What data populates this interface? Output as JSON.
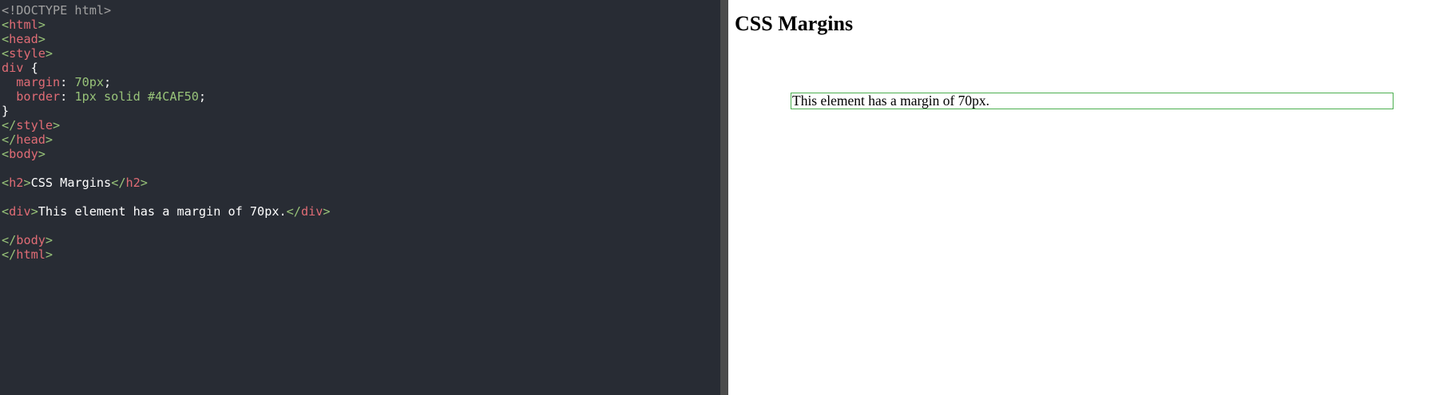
{
  "editor": {
    "lines": [
      [
        {
          "t": "<!DOCTYPE html>",
          "c": "doctype"
        }
      ],
      [
        {
          "t": "<",
          "c": "punct"
        },
        {
          "t": "html",
          "c": "tag"
        },
        {
          "t": ">",
          "c": "punct"
        }
      ],
      [
        {
          "t": "<",
          "c": "punct"
        },
        {
          "t": "head",
          "c": "tag"
        },
        {
          "t": ">",
          "c": "punct"
        }
      ],
      [
        {
          "t": "<",
          "c": "punct"
        },
        {
          "t": "style",
          "c": "tag"
        },
        {
          "t": ">",
          "c": "punct"
        }
      ],
      [
        {
          "t": "div",
          "c": "tag"
        },
        {
          "t": " {",
          "c": "text"
        }
      ],
      [
        {
          "t": "  margin",
          "c": "prop"
        },
        {
          "t": ": ",
          "c": "text"
        },
        {
          "t": "70px",
          "c": "val"
        },
        {
          "t": ";",
          "c": "text"
        }
      ],
      [
        {
          "t": "  border",
          "c": "prop"
        },
        {
          "t": ": ",
          "c": "text"
        },
        {
          "t": "1px solid #4CAF50",
          "c": "val"
        },
        {
          "t": ";",
          "c": "text"
        }
      ],
      [
        {
          "t": "}",
          "c": "text"
        }
      ],
      [
        {
          "t": "</",
          "c": "punct"
        },
        {
          "t": "style",
          "c": "tag"
        },
        {
          "t": ">",
          "c": "punct"
        }
      ],
      [
        {
          "t": "</",
          "c": "punct"
        },
        {
          "t": "head",
          "c": "tag"
        },
        {
          "t": ">",
          "c": "punct"
        }
      ],
      [
        {
          "t": "<",
          "c": "punct"
        },
        {
          "t": "body",
          "c": "tag"
        },
        {
          "t": ">",
          "c": "punct"
        }
      ],
      [],
      [
        {
          "t": "<",
          "c": "punct"
        },
        {
          "t": "h2",
          "c": "tag"
        },
        {
          "t": ">",
          "c": "punct"
        },
        {
          "t": "CSS Margins",
          "c": "text"
        },
        {
          "t": "</",
          "c": "punct"
        },
        {
          "t": "h2",
          "c": "tag"
        },
        {
          "t": ">",
          "c": "punct"
        }
      ],
      [],
      [
        {
          "t": "<",
          "c": "punct"
        },
        {
          "t": "div",
          "c": "tag"
        },
        {
          "t": ">",
          "c": "punct"
        },
        {
          "t": "This element has a margin of 70px.",
          "c": "text"
        },
        {
          "t": "</",
          "c": "punct"
        },
        {
          "t": "div",
          "c": "tag"
        },
        {
          "t": ">",
          "c": "punct"
        }
      ],
      [],
      [
        {
          "t": "</",
          "c": "punct"
        },
        {
          "t": "body",
          "c": "tag"
        },
        {
          "t": ">",
          "c": "punct"
        }
      ],
      [
        {
          "t": "</",
          "c": "punct"
        },
        {
          "t": "html",
          "c": "tag"
        },
        {
          "t": ">",
          "c": "punct"
        }
      ]
    ],
    "colors": {
      "background": "#282c34",
      "doctype": "#a0a0a0",
      "punct": "#98c379",
      "tag": "#e06c75",
      "value": "#98c379",
      "text": "#ffffff"
    }
  },
  "preview": {
    "heading": "CSS Margins",
    "box_text": "This element has a margin of 70px.",
    "box_border_color": "#4CAF50"
  }
}
